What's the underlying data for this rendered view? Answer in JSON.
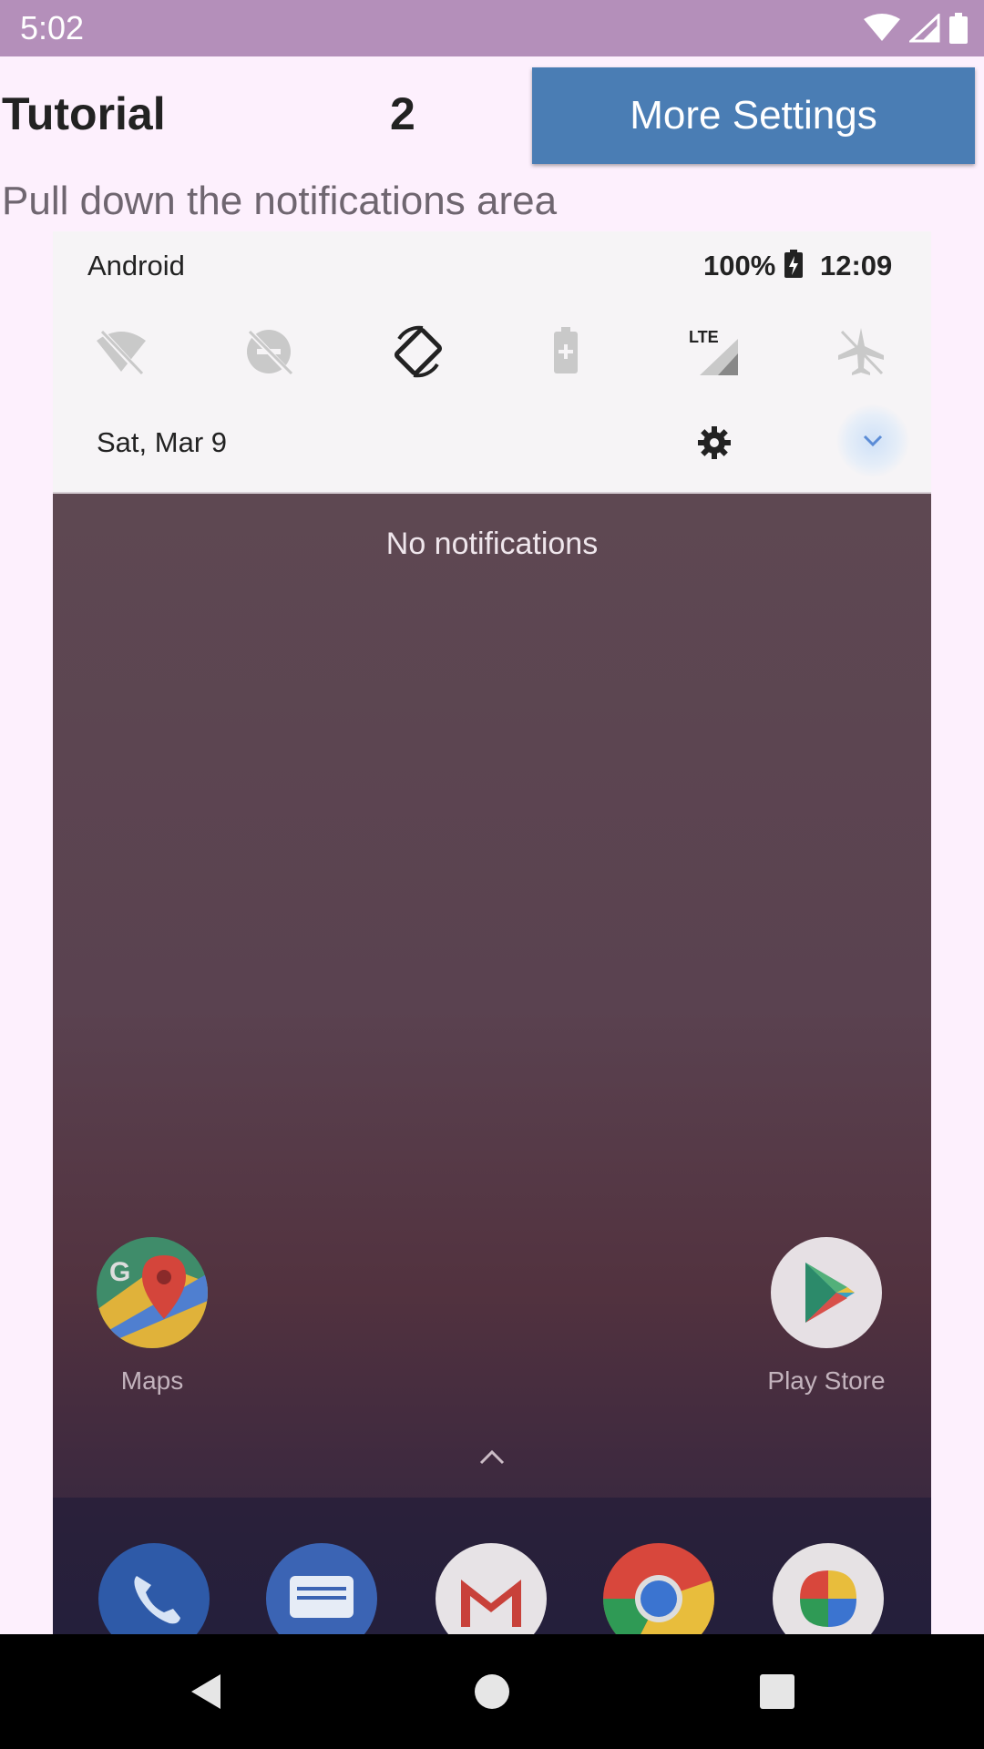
{
  "status_bar": {
    "time": "5:02"
  },
  "header": {
    "title": "Tutorial",
    "step": "2",
    "more_button_label": "More Settings"
  },
  "instruction": "Pull down the notifications area",
  "tutorial_image": {
    "shade": {
      "carrier": "Android",
      "battery": "100%",
      "clock": "12:09",
      "date": "Sat, Mar 9"
    },
    "no_notifications": "No notifications",
    "apps": [
      {
        "label": "Maps"
      },
      {
        "label": "Play Store"
      }
    ]
  },
  "colors": {
    "status_bar": "#b48fba",
    "background": "#fdf0fd",
    "button": "#4a7db4"
  }
}
